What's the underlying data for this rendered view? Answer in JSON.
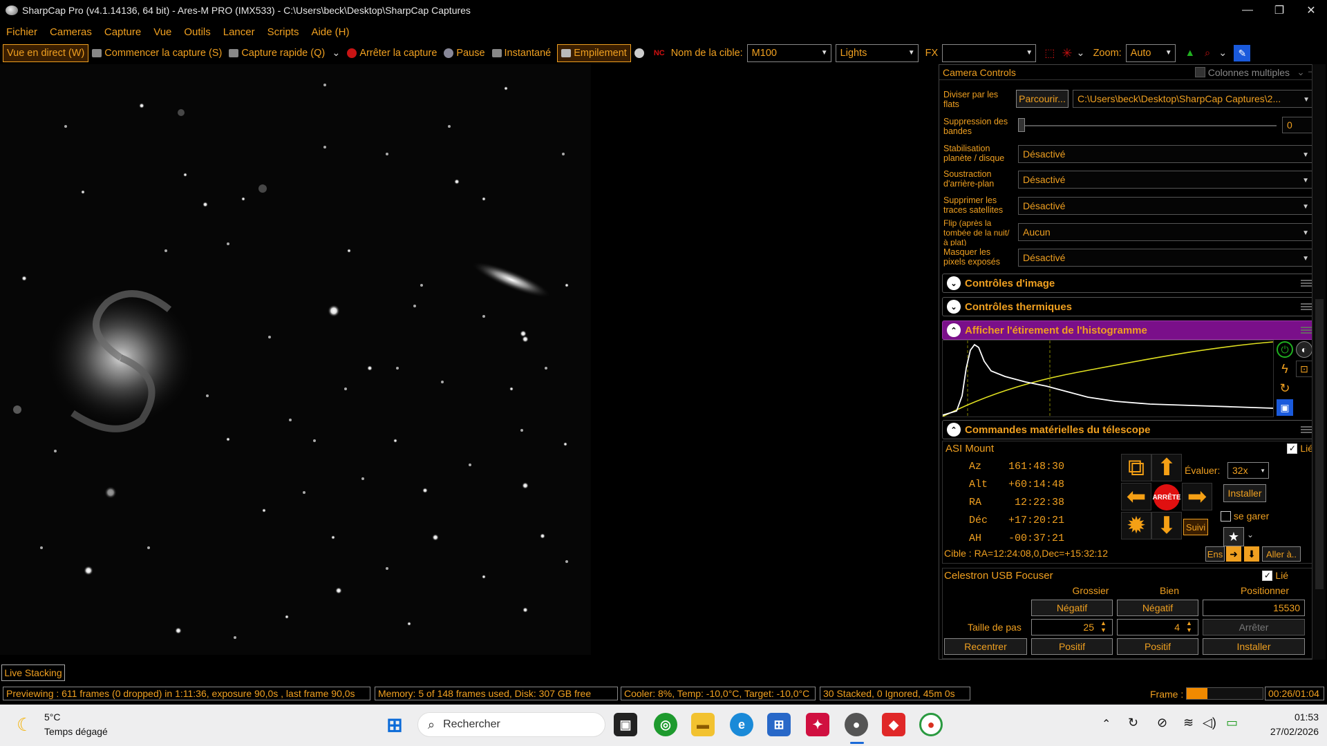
{
  "window": {
    "title": "SharpCap Pro (v4.1.14136, 64 bit) - Ares-M PRO (IMX533) - C:\\Users\\beck\\Desktop\\SharpCap Captures"
  },
  "menu": [
    "Fichier",
    "Cameras",
    "Capture",
    "Vue",
    "Outils",
    "Lancer",
    "Scripts",
    "Aide (H)"
  ],
  "toolbar": {
    "live_view": "Vue en direct (W)",
    "start_capture": "Commencer la capture (S)",
    "quick_capture": "Capture rapide (Q)",
    "stop_capture": "Arrêter la capture",
    "pause": "Pause",
    "snapshot": "Instantané",
    "stacking": "Empilement",
    "target_label": "Nom de la cible:",
    "target_value": "M100",
    "frame_type": "Lights",
    "fx_label": "FX",
    "fx_value": "",
    "zoom_label": "Zoom:",
    "zoom_value": "Auto"
  },
  "panel": {
    "title": "Camera Controls",
    "multi_columns": "Colonnes multiples",
    "rows": [
      {
        "label": "Diviser par les flats",
        "button": "Parcourir...",
        "value": "C:\\Users\\beck\\Desktop\\SharpCap Captures\\2..."
      },
      {
        "label": "Suppression des bandes",
        "value": "0"
      },
      {
        "label": "Stabilisation planète / disque",
        "value": "Désactivé"
      },
      {
        "label": "Soustraction d'arrière-plan",
        "value": "Désactivé"
      },
      {
        "label": "Supprimer les traces satellites",
        "value": "Désactivé"
      },
      {
        "label": "Flip (après la tombée de la nuit/à plat)",
        "value": "Aucun"
      },
      {
        "label": "Masquer les pixels exposés",
        "value": "Désactivé"
      }
    ],
    "sections": {
      "image_controls": "Contrôles d'image",
      "thermal_controls": "Contrôles thermiques",
      "histogram": "Afficher l'étirement de l'histogramme",
      "telescope": "Commandes matérielles du télescope"
    }
  },
  "mount": {
    "name": "ASI Mount",
    "linked": "Lié",
    "az_label": "Az",
    "az": "161:48:30",
    "alt_label": "Alt",
    "alt": "+60:14:48",
    "ra_label": "RA",
    "ra": "12:22:38",
    "dec_label": "Déc",
    "dec": "+17:20:21",
    "ha_label": "AH",
    "ha": "-00:37:21",
    "rate_label": "Évaluer:",
    "rate": "32x",
    "install": "Installer",
    "park": "se garer",
    "stop": "ARRÊTE",
    "track": "Suivi",
    "target": "Cible : RA=12:24:08,0,Dec=+15:32:12",
    "ens": "Ens",
    "goto": "Aller à.."
  },
  "focuser": {
    "name": "Celestron USB Focuser",
    "linked": "Lié",
    "coarse": "Grossier",
    "fine": "Bien",
    "position_label": "Positionner",
    "neg": "Négatif",
    "pos": "Positif",
    "position": "15530",
    "step_label": "Taille de pas",
    "coarse_step": "25",
    "fine_step": "4",
    "stop": "Arrêter",
    "recenter": "Recentrer",
    "install": "Installer"
  },
  "live_stacking_tab": "Live Stacking",
  "statusbar": {
    "preview": "Previewing : 611 frames (0 dropped) in 1:11:36, exposure 90,0s , last frame 90,0s",
    "memory": "Memory: 5 of 148 frames used, Disk: 307 GB free",
    "cooler": "Cooler: 8%, Temp: -10,0°C, Target: -10,0°C",
    "stacked": "30 Stacked, 0 Ignored, 45m 0s",
    "frame_label": "Frame :",
    "frame_progress": 0.27,
    "time": "00:26/01:04"
  },
  "taskbar": {
    "weather_temp": "5°C",
    "weather_desc": "Temps dégagé",
    "search": "Rechercher",
    "clock": "01:53",
    "date": "27/02/2026"
  },
  "colors": {
    "accent": "#f0a020",
    "histogram_header": "#7a0f8a",
    "stop_red": "#e01010"
  }
}
